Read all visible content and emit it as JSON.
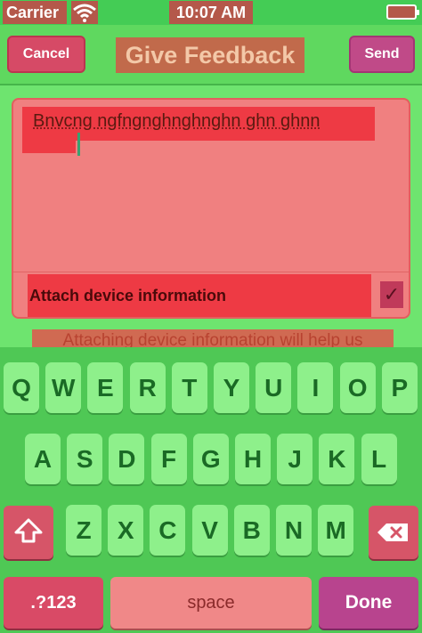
{
  "status_bar": {
    "carrier": "Carrier",
    "time": "10:07 AM"
  },
  "nav": {
    "cancel_label": "Cancel",
    "title": "Give Feedback",
    "send_label": "Send"
  },
  "feedback": {
    "text": "Bnvcng ngfngnghnghnghn ghn ghnn",
    "attach_label": "Attach device information",
    "attach_checked": true,
    "info_text": "Attaching device information will help us"
  },
  "keyboard": {
    "row1": [
      "Q",
      "W",
      "E",
      "R",
      "T",
      "Y",
      "U",
      "I",
      "O",
      "P"
    ],
    "row2": [
      "A",
      "S",
      "D",
      "F",
      "G",
      "H",
      "J",
      "K",
      "L"
    ],
    "row3": [
      "Z",
      "X",
      "C",
      "V",
      "B",
      "N",
      "M"
    ],
    "numbers_label": ".?123",
    "space_label": "space",
    "done_label": "Done"
  },
  "colors": {
    "background": "#6ee46f",
    "card": "#f08080",
    "highlight": "#ee3a44",
    "key": "#8ef08b"
  }
}
